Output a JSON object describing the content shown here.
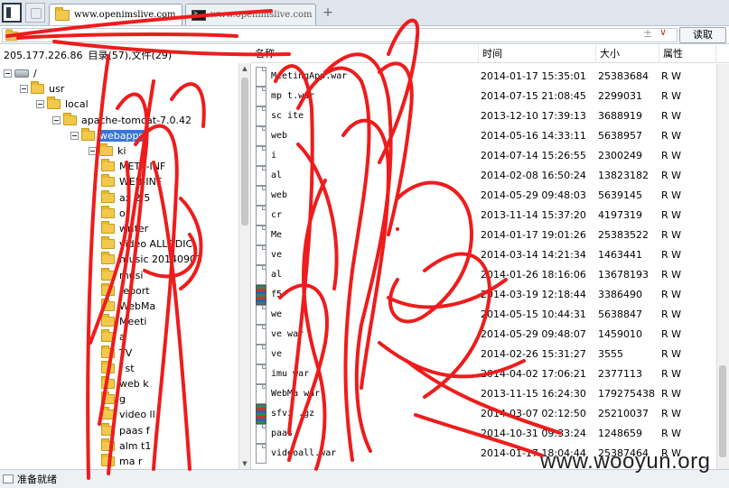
{
  "tabs": [
    {
      "label": "www.openimslive.com",
      "icon": "folder-icon",
      "active": true
    },
    {
      "label": "www.openimslive.com",
      "icon": "terminal-icon",
      "active": false
    }
  ],
  "tab_add": "+",
  "path": {
    "value": "",
    "add_symbol": "±",
    "dropdown_symbol": "∨",
    "read_label": "读取"
  },
  "info": {
    "ip": "205.177.226.86",
    "counts": "目录(57),文件(29)"
  },
  "columns": {
    "name": "名称",
    "time": "时间",
    "size": "大小",
    "attr": "属性"
  },
  "tree": [
    {
      "label": "/",
      "icon": "drive-icon",
      "expander": true
    },
    {
      "label": "usr",
      "icon": "folder-icon",
      "expander": true
    },
    {
      "label": "local",
      "icon": "folder-icon",
      "expander": true
    },
    {
      "label": "apache-tomcat-7.0.42",
      "icon": "folder-icon",
      "expander": true
    },
    {
      "label": "webapps",
      "icon": "folder-icon",
      "expander": true,
      "selected": true
    },
    {
      "label": "ki",
      "icon": "folder-icon",
      "expander": true
    },
    {
      "label": "META-INF",
      "icon": "folder-icon"
    },
    {
      "label": "WEB-INF",
      "icon": "folder-icon"
    },
    {
      "label": "ax 2.5",
      "icon": "folder-icon"
    },
    {
      "label": "or",
      "icon": "folder-icon"
    },
    {
      "label": "writer",
      "icon": "folder-icon"
    },
    {
      "label": "video ALLDDIC",
      "icon": "folder-icon"
    },
    {
      "label": "music 20140903",
      "icon": "folder-icon"
    },
    {
      "label": "musi",
      "icon": "folder-icon"
    },
    {
      "label": "report",
      "icon": "folder-icon"
    },
    {
      "label": "WebMa",
      "icon": "folder-icon"
    },
    {
      "label": "Meeti",
      "icon": "folder-icon"
    },
    {
      "label": "a",
      "icon": "folder-icon"
    },
    {
      "label": "TV",
      "icon": "folder-icon"
    },
    {
      "label": "i st",
      "icon": "folder-icon"
    },
    {
      "label": "web k",
      "icon": "folder-icon"
    },
    {
      "label": "g",
      "icon": "folder-icon"
    },
    {
      "label": "video ll",
      "icon": "folder-icon"
    },
    {
      "label": "paas f",
      "icon": "folder-icon"
    },
    {
      "label": "alm t1",
      "icon": "folder-icon"
    },
    {
      "label": "ma r",
      "icon": "folder-icon"
    }
  ],
  "files": [
    {
      "name": "MeetingApp.war",
      "time": "2014-01-17 15:35:01",
      "size": "25383684",
      "attr": "R W",
      "icon": "file-icon"
    },
    {
      "name": "mp t.war",
      "time": "2014-07-15 21:08:45",
      "size": "2299031",
      "attr": "R W",
      "icon": "file-icon"
    },
    {
      "name": "sc ite",
      "time": "2013-12-10 17:39:13",
      "size": "3688919",
      "attr": "R W",
      "icon": "file-icon"
    },
    {
      "name": "web",
      "time": "2014-05-16 14:33:11",
      "size": "5638957",
      "attr": "R W",
      "icon": "file-icon"
    },
    {
      "name": "i",
      "time": "2014-07-14 15:26:55",
      "size": "2300249",
      "attr": "R W",
      "icon": "file-icon"
    },
    {
      "name": "al",
      "time": "2014-02-08 16:50:24",
      "size": "13823182",
      "attr": "R W",
      "icon": "file-icon"
    },
    {
      "name": "web",
      "time": "2014-05-29 09:48:03",
      "size": "5639145",
      "attr": "R W",
      "icon": "file-icon"
    },
    {
      "name": "cr",
      "time": "2013-11-14 15:37:20",
      "size": "4197319",
      "attr": "R W",
      "icon": "file-icon"
    },
    {
      "name": "Me",
      "time": "2014-01-17 19:01:26",
      "size": "25383522",
      "attr": "R W",
      "icon": "file-icon"
    },
    {
      "name": "ve",
      "time": "2014-03-14 14:21:34",
      "size": "1463441",
      "attr": "R W",
      "icon": "file-icon"
    },
    {
      "name": "al",
      "time": "2014-01-26 18:16:06",
      "size": "13678193",
      "attr": "R W",
      "icon": "file-icon"
    },
    {
      "name": "f5",
      "time": "2014-03-19 12:18:44",
      "size": "3386490",
      "attr": "R W",
      "icon": "archive-icon"
    },
    {
      "name": "we",
      "time": "2014-05-15 10:44:31",
      "size": "5638847",
      "attr": "R W",
      "icon": "file-icon"
    },
    {
      "name": "ve war",
      "time": "2014-05-29 09:48:07",
      "size": "1459010",
      "attr": "R W",
      "icon": "file-icon"
    },
    {
      "name": "ve",
      "time": "2014-02-26 15:31:27",
      "size": "3555",
      "attr": "R W",
      "icon": "file-icon"
    },
    {
      "name": "imu war",
      "time": "2014-04-02 17:06:21",
      "size": "2377113",
      "attr": "R W",
      "icon": "file-icon"
    },
    {
      "name": "WebMa war",
      "time": "2013-11-15 16:24:30",
      "size": "179275438",
      "attr": "R W",
      "icon": "file-icon"
    },
    {
      "name": "sfvi .gz",
      "time": "2014-03-07 02:12:50",
      "size": "25210037",
      "attr": "R W",
      "icon": "archive-icon"
    },
    {
      "name": "paas",
      "time": "2014-10-31 09:33:24",
      "size": "1248659",
      "attr": "R W",
      "icon": "file-icon"
    },
    {
      "name": "videoall.war",
      "time": "2014-01-17 18:04:44",
      "size": "25387464",
      "attr": "R W",
      "icon": "file-icon"
    }
  ],
  "status": "准备就绪",
  "watermark": "www.wooyun.org",
  "colors": {
    "selection": "#3875d7",
    "scribble": "#ee1c1c",
    "folder": "#f2c94c"
  }
}
